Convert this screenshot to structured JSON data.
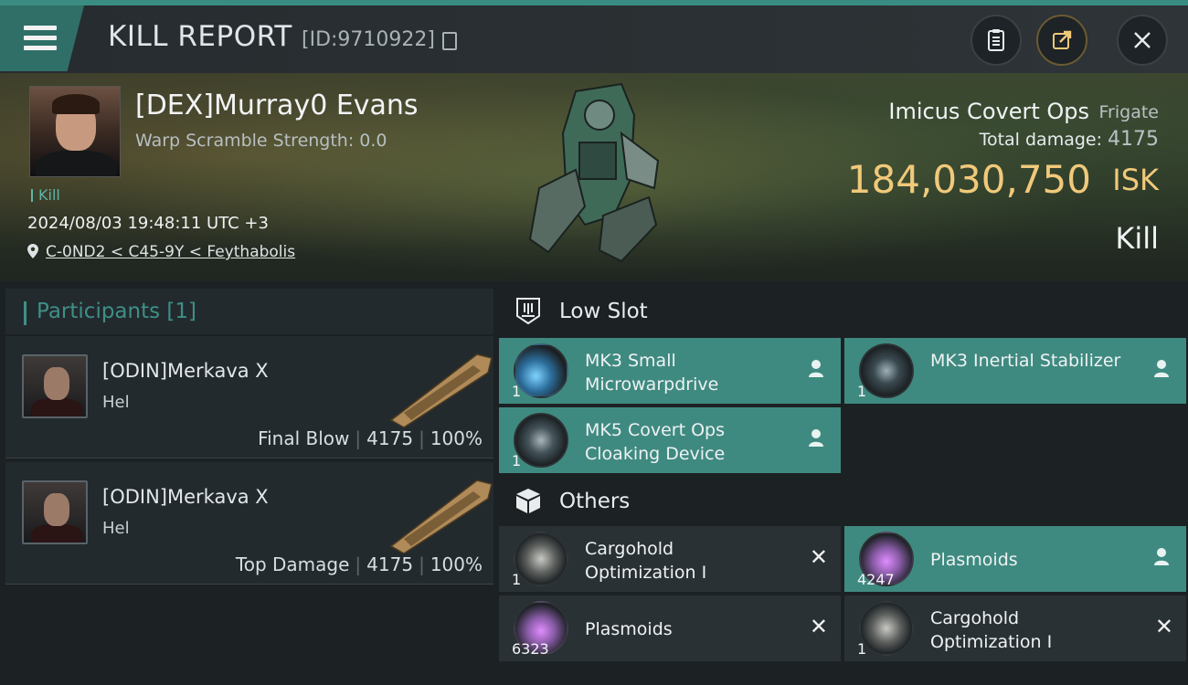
{
  "header": {
    "title": "KILL REPORT",
    "report_id": "[ID:9710922]"
  },
  "victim": {
    "name": "[DEX]Murray0 Evans",
    "warp_scramble": "Warp Scramble Strength: 0.0",
    "kill_tag": "Kill",
    "timestamp": "2024/08/03 19:48:11 UTC +3",
    "location": "C-0ND2 < C45-9Y < Feythabolis",
    "ship_name": "Imicus Covert Ops",
    "ship_class": "Frigate",
    "total_damage_label": "Total damage:",
    "total_damage_value": "4175",
    "isk_value": "184,030,750",
    "isk_unit": "ISK",
    "result": "Kill"
  },
  "participants": {
    "title": "Participants [1]",
    "items": [
      {
        "name": "[ODIN]Merkava X",
        "ship": "Hel",
        "role": "Final Blow",
        "damage": "4175",
        "percent": "100%"
      },
      {
        "name": "[ODIN]Merkava X",
        "ship": "Hel",
        "role": "Top Damage",
        "damage": "4175",
        "percent": "100%"
      }
    ]
  },
  "low_slot": {
    "label": "Low Slot",
    "items": [
      {
        "name": "MK3 Small Microwarpdrive",
        "qty": "1",
        "status": "destroyed-by-pilot"
      },
      {
        "name": "MK3 Inertial Stabilizer",
        "qty": "1",
        "status": "destroyed-by-pilot"
      },
      {
        "name": "MK5 Covert Ops Cloaking Device",
        "qty": "1",
        "status": "destroyed-by-pilot"
      }
    ]
  },
  "others": {
    "label": "Others",
    "items": [
      {
        "name": "Cargohold Optimization I",
        "qty": "1",
        "status": "destroyed"
      },
      {
        "name": "Plasmoids",
        "qty": "4247",
        "status": "dropped"
      },
      {
        "name": "Plasmoids",
        "qty": "6323",
        "status": "destroyed"
      },
      {
        "name": "Cargohold Optimization I",
        "qty": "1",
        "status": "destroyed"
      }
    ]
  },
  "icons": {
    "x_mark": "✕"
  },
  "colors": {
    "accent": "#3f8a80",
    "isk": "#f0c97a",
    "teal_text": "#3f8f86"
  }
}
